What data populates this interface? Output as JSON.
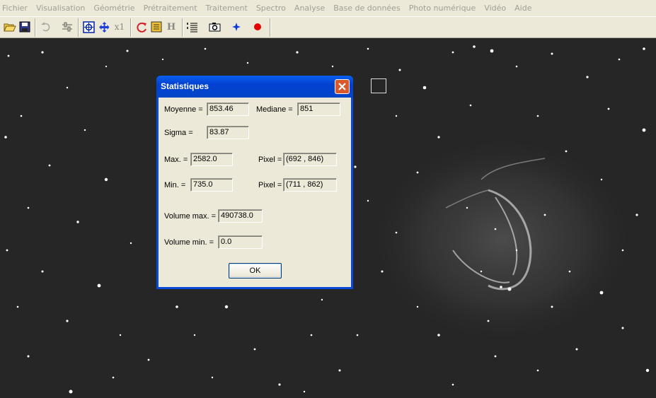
{
  "menubar": {
    "items": [
      "Fichier",
      "Visualisation",
      "Géométrie",
      "Prétraitement",
      "Traitement",
      "Spectro",
      "Analyse",
      "Base de données",
      "Photo numérique",
      "Vidéo",
      "Aide"
    ]
  },
  "toolbar": {
    "icons": [
      "open-folder-icon",
      "save-icon",
      "undo-icon",
      "settings-sliders-icon",
      "zoom-fit-icon",
      "pan-icon",
      "zoom-x1-icon",
      "refresh-icon",
      "list-icon",
      "histogram-icon",
      "numbered-list-icon",
      "camera-icon",
      "star-marker-icon",
      "record-icon"
    ],
    "x1_label": "x1",
    "h_label": "H"
  },
  "dialog": {
    "title": "Statistiques",
    "moyenne_label": "Moyenne =",
    "moyenne_value": "853.46",
    "mediane_label": "Mediane =",
    "mediane_value": "851",
    "sigma_label": "Sigma =",
    "sigma_value": "83.87",
    "max_label": "Max. =",
    "max_value": "2582.0",
    "max_pixel_label": "Pixel =",
    "max_pixel_value": "(692 , 846)",
    "min_label": "Min. =",
    "min_value": "735.0",
    "min_pixel_label": "Pixel =",
    "min_pixel_value": "(711 , 862)",
    "volume_max_label": "Volume max. =",
    "volume_max_value": "490738.0",
    "volume_min_label": "Volume min. =",
    "volume_min_value": "0.0",
    "ok_label": "OK"
  },
  "colors": {
    "titlebar": "#0a49d8",
    "dialog_bg": "#ece9d8",
    "sky": "#262626",
    "close_button": "#d9582c"
  }
}
